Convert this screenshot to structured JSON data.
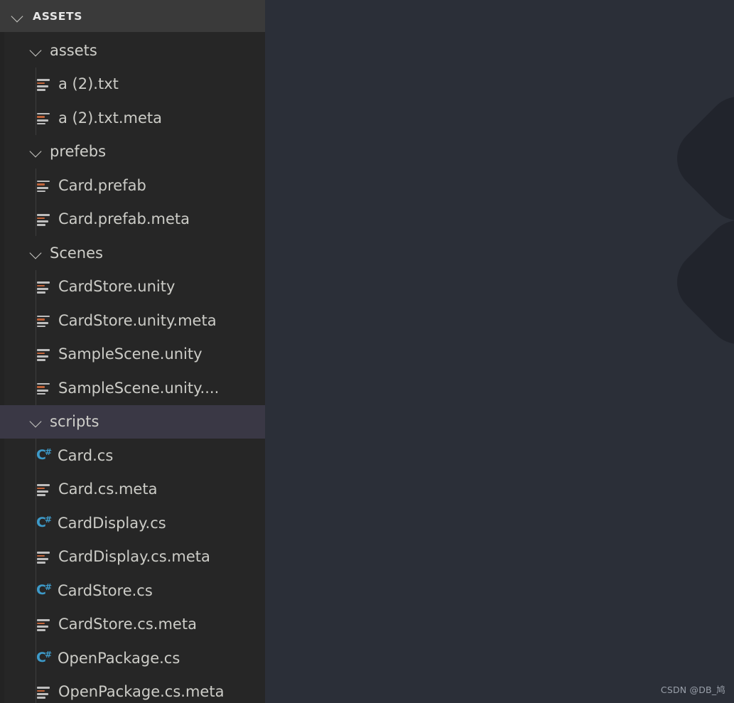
{
  "colors": {
    "sidebar_background": "#262626",
    "sidebar_header_background": "#3a3a3a",
    "editor_background": "#2b2f38",
    "decoration_shape": "#21242c",
    "selection_background": "#3a3845",
    "text_primary": "#ccccc7",
    "csharp_accent": "#3d9ac9",
    "file_icon_accent": "#c1643a",
    "watermark_text": "#9aa0aa"
  },
  "sidebar": {
    "header": {
      "title": "ASSETS",
      "chevron": "chevron-down-icon"
    },
    "tree": [
      {
        "label": "assets",
        "type": "folder",
        "indent": 1,
        "icon": "chevron-down-icon",
        "expanded": true,
        "selected": false
      },
      {
        "label": "a (2).txt",
        "type": "file",
        "indent": 2,
        "icon": "text-file-icon",
        "selected": false
      },
      {
        "label": "a (2).txt.meta",
        "type": "file",
        "indent": 2,
        "icon": "text-file-icon",
        "selected": false
      },
      {
        "label": "prefebs",
        "type": "folder",
        "indent": 1,
        "icon": "chevron-down-icon",
        "expanded": true,
        "selected": false
      },
      {
        "label": "Card.prefab",
        "type": "file",
        "indent": 2,
        "icon": "text-file-icon",
        "selected": false
      },
      {
        "label": "Card.prefab.meta",
        "type": "file",
        "indent": 2,
        "icon": "text-file-icon",
        "selected": false
      },
      {
        "label": "Scenes",
        "type": "folder",
        "indent": 1,
        "icon": "chevron-down-icon",
        "expanded": true,
        "selected": false
      },
      {
        "label": "CardStore.unity",
        "type": "file",
        "indent": 2,
        "icon": "text-file-icon",
        "selected": false
      },
      {
        "label": "CardStore.unity.meta",
        "type": "file",
        "indent": 2,
        "icon": "text-file-icon",
        "selected": false
      },
      {
        "label": "SampleScene.unity",
        "type": "file",
        "indent": 2,
        "icon": "text-file-icon",
        "selected": false
      },
      {
        "label": "SampleScene.unity....",
        "type": "file",
        "indent": 2,
        "icon": "text-file-icon",
        "selected": false
      },
      {
        "label": "scripts",
        "type": "folder",
        "indent": 1,
        "icon": "chevron-down-icon",
        "expanded": true,
        "selected": true
      },
      {
        "label": "Card.cs",
        "type": "file",
        "indent": 2,
        "icon": "csharp-icon",
        "selected": false
      },
      {
        "label": "Card.cs.meta",
        "type": "file",
        "indent": 2,
        "icon": "text-file-icon",
        "selected": false
      },
      {
        "label": "CardDisplay.cs",
        "type": "file",
        "indent": 2,
        "icon": "csharp-icon",
        "selected": false
      },
      {
        "label": "CardDisplay.cs.meta",
        "type": "file",
        "indent": 2,
        "icon": "text-file-icon",
        "selected": false
      },
      {
        "label": "CardStore.cs",
        "type": "file",
        "indent": 2,
        "icon": "csharp-icon",
        "selected": false
      },
      {
        "label": "CardStore.cs.meta",
        "type": "file",
        "indent": 2,
        "icon": "text-file-icon",
        "selected": false
      },
      {
        "label": "OpenPackage.cs",
        "type": "file",
        "indent": 2,
        "icon": "csharp-icon",
        "selected": false
      },
      {
        "label": "OpenPackage.cs.meta",
        "type": "file",
        "indent": 2,
        "icon": "text-file-icon",
        "selected": false
      }
    ]
  },
  "editor": {
    "watermark": "CSDN @DB_鸠",
    "decorations": [
      {
        "name": "rounded-diamond-shape",
        "index": 1
      },
      {
        "name": "rounded-diamond-shape",
        "index": 2
      }
    ]
  }
}
